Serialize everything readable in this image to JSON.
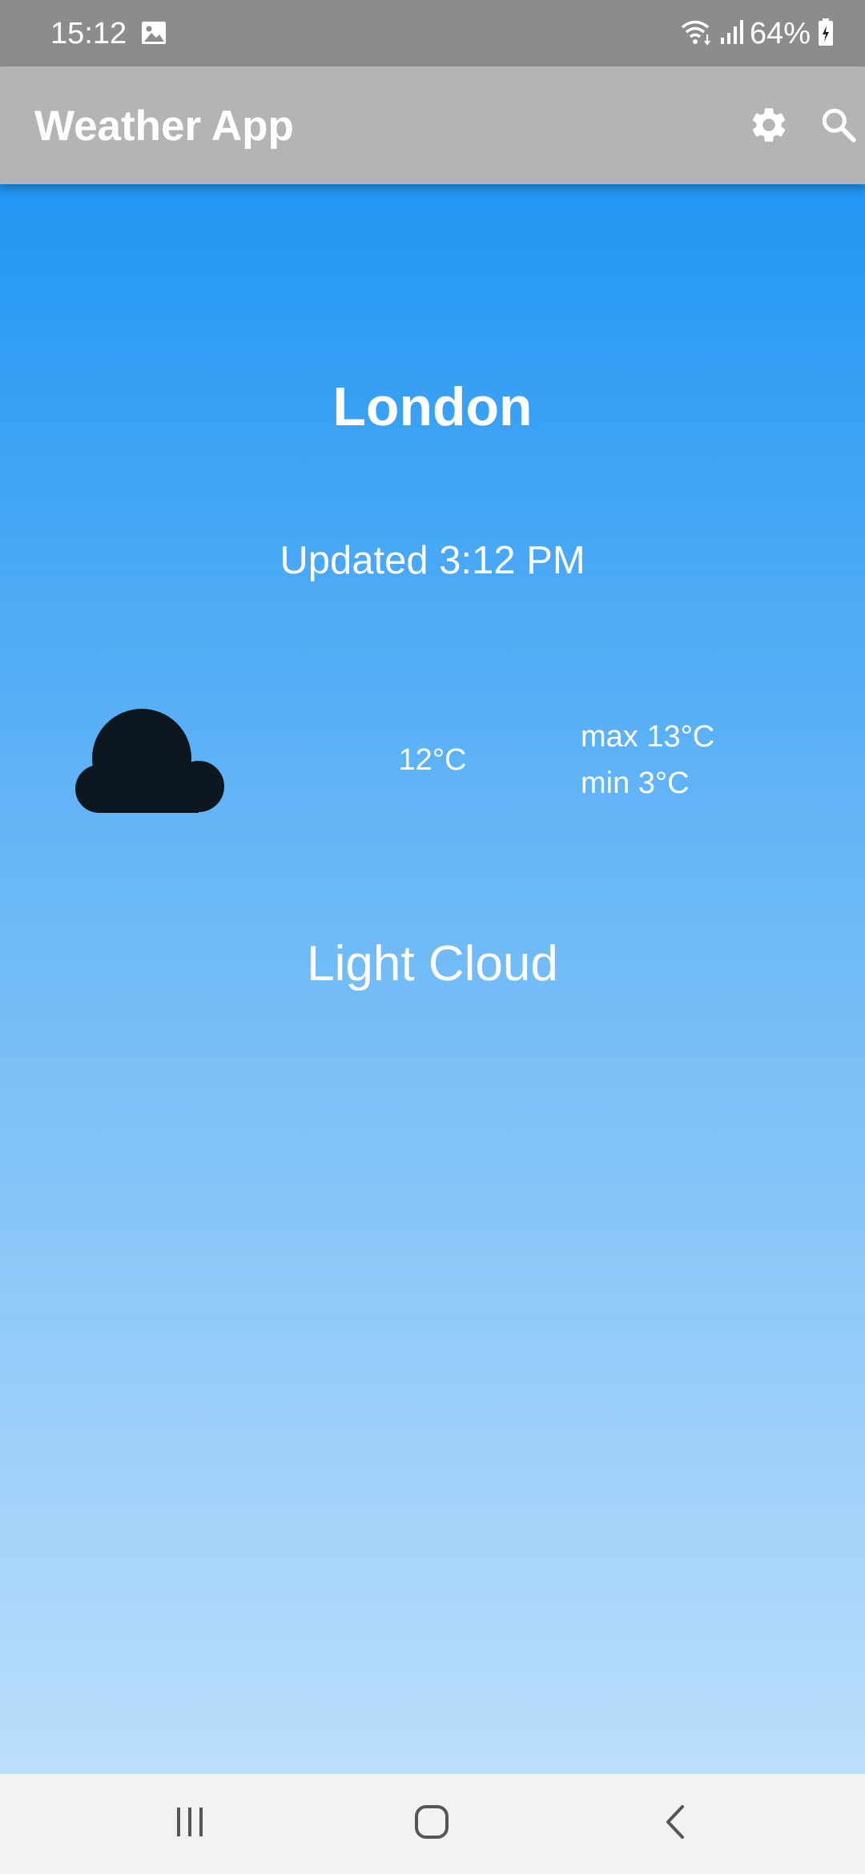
{
  "status_bar": {
    "time": "15:12",
    "battery": "64%",
    "icons": [
      "gallery-icon",
      "wifi-icon",
      "signal-icon",
      "battery-icon"
    ]
  },
  "app_bar": {
    "title": "Weather App",
    "actions": [
      "settings-icon",
      "search-icon"
    ]
  },
  "weather": {
    "city": "London",
    "updated": "Updated 3:12 PM",
    "current_temp": "12°C",
    "max_temp": "max 13°C",
    "min_temp": "min 3°C",
    "condition": "Light Cloud",
    "condition_icon": "cloud-icon"
  },
  "nav_bar": {
    "buttons": [
      "recents-icon",
      "home-icon",
      "back-icon"
    ]
  },
  "colors": {
    "status_bar": "#8c8c8c",
    "app_bar": "#b4b4b4",
    "gradient_top": "#2196f3",
    "gradient_bottom": "#bbdefb",
    "cloud": "#0d1720",
    "nav_bar": "#f2f2f2"
  }
}
